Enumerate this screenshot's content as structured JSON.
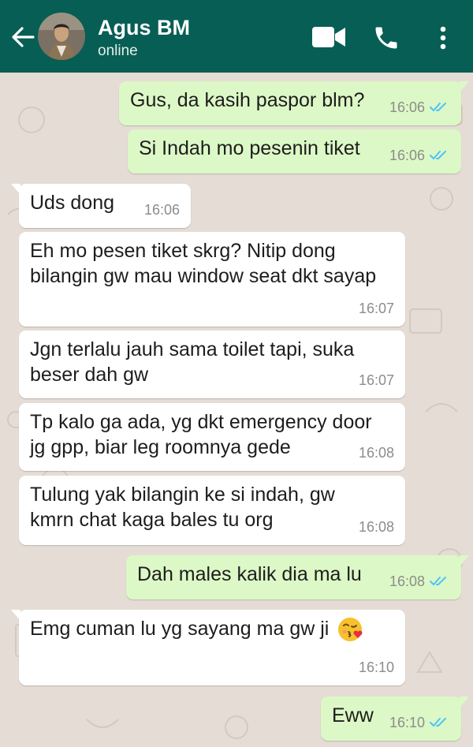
{
  "header": {
    "contact_name": "Agus BM",
    "status": "online",
    "background_color": "#075e54",
    "icons": [
      "back-arrow-icon",
      "video-call-icon",
      "voice-call-icon",
      "more-options-icon"
    ]
  },
  "chat": {
    "background_color": "#e5ddd5",
    "outgoing_color": "#dcf8c6",
    "incoming_color": "#ffffff",
    "read_tick_color": "#4fc3f7",
    "messages": [
      {
        "direction": "out",
        "text": "Gus, da kasih paspor blm?",
        "time": "16:06",
        "read": true
      },
      {
        "direction": "out",
        "text": "Si Indah mo pesenin tiket",
        "time": "16:06",
        "read": true
      },
      {
        "direction": "in",
        "text": "Uds dong",
        "time": "16:06"
      },
      {
        "direction": "in",
        "text": "Eh mo pesen tiket skrg? Nitip dong bilangin gw mau window seat dkt sayap",
        "time": "16:07"
      },
      {
        "direction": "in",
        "text": "Jgn terlalu jauh sama toilet tapi, suka beser dah gw",
        "time": "16:07"
      },
      {
        "direction": "in",
        "text": "Tp kalo ga ada, yg dkt emergency door jg gpp, biar leg roomnya gede",
        "time": "16:08"
      },
      {
        "direction": "in",
        "text": "Tulung yak bilangin ke si indah, gw kmrn chat kaga bales tu org",
        "time": "16:08"
      },
      {
        "direction": "out",
        "text": "Dah males kalik dia ma lu",
        "time": "16:08",
        "read": true
      },
      {
        "direction": "in",
        "text": "Emg cuman lu yg sayang ma gw ji",
        "time": "16:10",
        "emoji": "kissing-face-with-heart-icon"
      },
      {
        "direction": "out",
        "text": "Eww",
        "time": "16:10",
        "read": true
      }
    ]
  }
}
